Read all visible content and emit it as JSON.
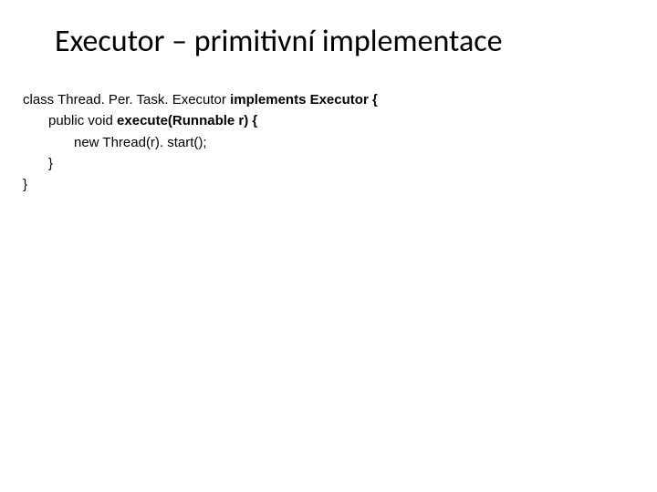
{
  "slide": {
    "title": "Executor – primitivní implementace",
    "code": {
      "line1_pre": "class Thread. Per. Task. Executor ",
      "line1_bold": "implements Executor {",
      "line2_pre": "public void ",
      "line2_bold": "execute(Runnable r) {",
      "line3": "new Thread(r). start();",
      "line4": "}",
      "line5": "}"
    }
  }
}
